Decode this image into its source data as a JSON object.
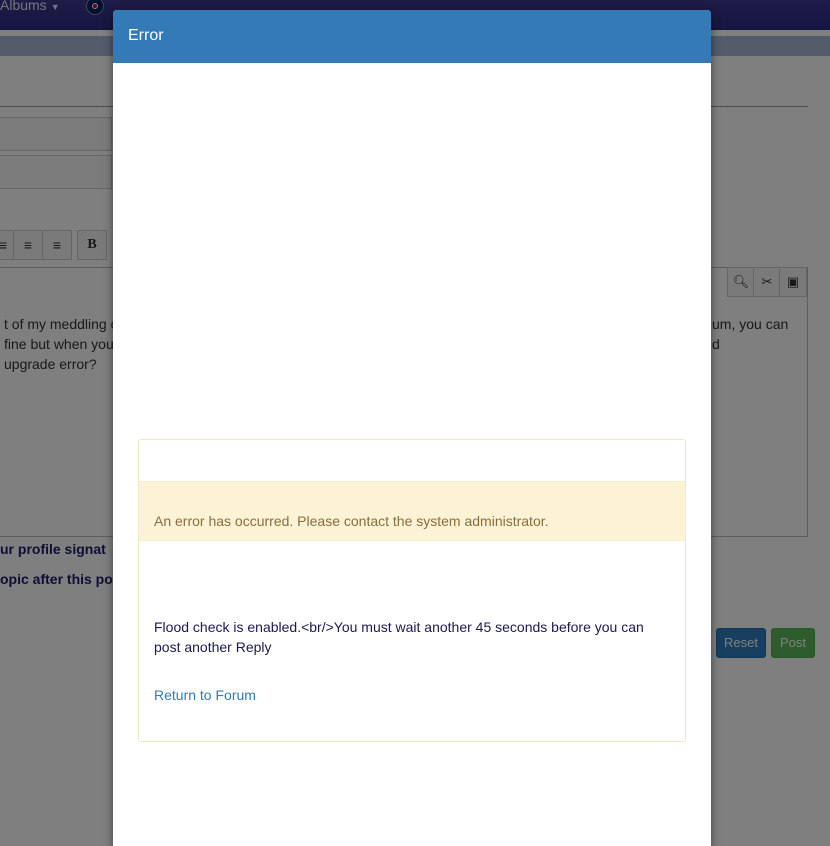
{
  "background": {
    "nav_albums": "Albums",
    "editor_lines_left": [
      "t of my meddling o",
      "fine but when you",
      " upgrade error?"
    ],
    "editor_lines_right": [
      "um, you can",
      "d"
    ],
    "option_1": "ur profile signat",
    "option_2": "opic after this po",
    "reset_label": "Reset",
    "post_label": "Post"
  },
  "modal": {
    "title": "Error",
    "alert": "An error has occurred. Please contact the system administrator.",
    "message": "Flood check is enabled.<br/>You must wait another 45 seconds before you can post another Reply",
    "link": "Return to Forum"
  },
  "colors": {
    "modal_header": "#337ab7",
    "alert_bg": "#fcf3d6",
    "alert_text": "#8a6d3b",
    "link": "#337ab7",
    "navbar": "#2c2a80"
  },
  "icons": [
    "caret-down-icon",
    "uk-flag-icon",
    "align-left-icon",
    "align-center-icon",
    "align-right-icon",
    "bold-icon",
    "search-icon",
    "attachment-icon",
    "image-icon",
    "resize-handle-icon"
  ]
}
